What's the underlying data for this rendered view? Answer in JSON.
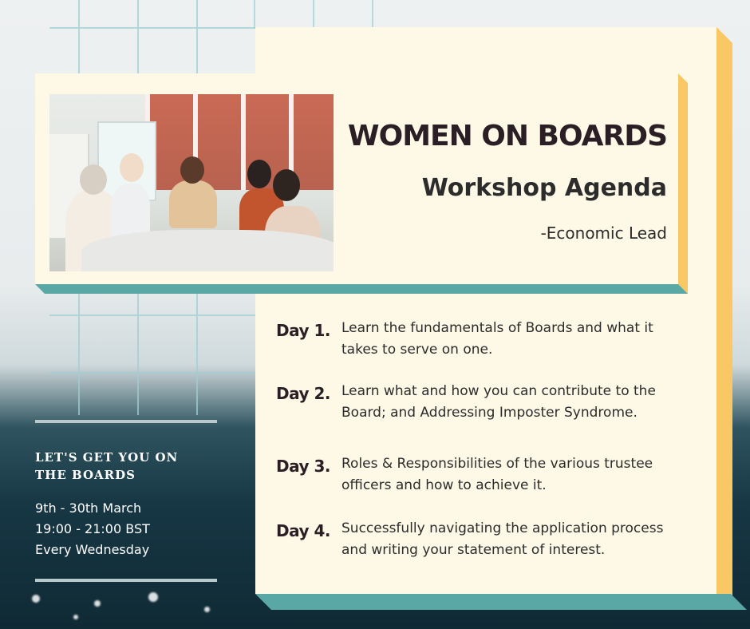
{
  "header": {
    "title": "WOMEN ON BOARDS",
    "subtitle": "Workshop Agenda",
    "byline": "-Economic Lead"
  },
  "agenda": [
    {
      "label": "Day 1.",
      "text": "Learn the fundamentals of Boards and what it takes to serve on one."
    },
    {
      "label": "Day 2.",
      "text": "Learn what and how you can contribute to the Board; and Addressing Imposter Syndrome."
    },
    {
      "label": "Day 3.",
      "text": "Roles & Responsibilities of the various trustee officers and how to achieve it."
    },
    {
      "label": "Day 4.",
      "text": "Successfully navigating the application process and writing your statement of interest."
    }
  ],
  "sidebar": {
    "cta": "LET'S  GET YOU ON\nTHE BOARDS",
    "dates": "9th - 30th March",
    "time": "19:00 - 21:00 BST",
    "frequency": "Every Wednesday"
  },
  "colors": {
    "card": "#fdf9e6",
    "teal_accent": "#5aa8a6",
    "yellow_accent": "#f9c864",
    "title_text": "#2c1e25"
  }
}
